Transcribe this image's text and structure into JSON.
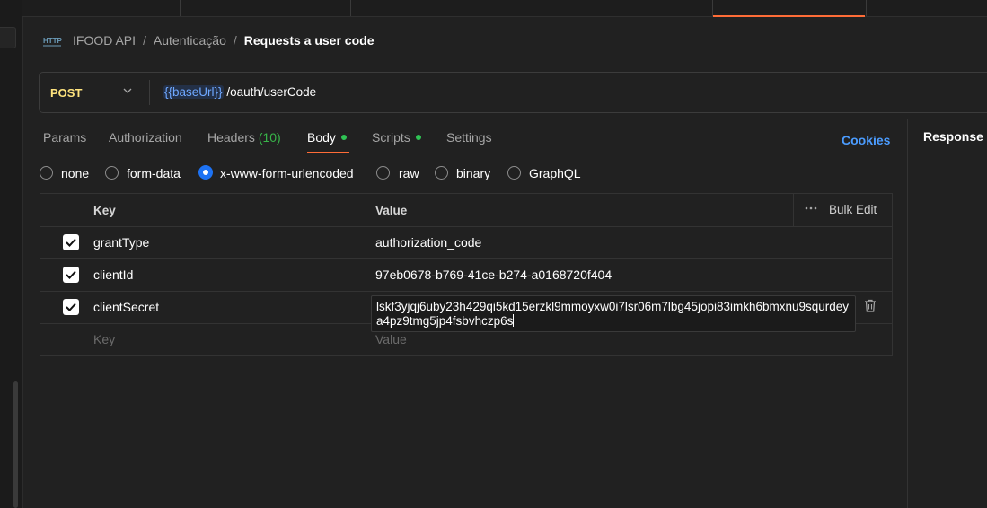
{
  "breadcrumb": {
    "collection": "IFOOD API",
    "folder": "Autenticação",
    "request": "Requests a user code",
    "icon": "http-icon"
  },
  "request": {
    "method": "POST",
    "url_variable": "{{baseUrl}}",
    "url_path": "/oauth/userCode"
  },
  "tabs": {
    "params": "Params",
    "authorization": "Authorization",
    "headers": "Headers",
    "headers_count": "(10)",
    "body": "Body",
    "scripts": "Scripts",
    "settings": "Settings",
    "active": "Body"
  },
  "cookies_label": "Cookies",
  "response_title": "Response",
  "body_types": {
    "options": [
      "none",
      "form-data",
      "x-www-form-urlencoded",
      "raw",
      "binary",
      "GraphQL"
    ],
    "selected": "x-www-form-urlencoded"
  },
  "table": {
    "key_header": "Key",
    "value_header": "Value",
    "bulk_edit": "Bulk Edit",
    "rows": [
      {
        "checked": true,
        "key": "grantType",
        "value": "authorization_code"
      },
      {
        "checked": true,
        "key": "clientId",
        "value": "97eb0678-b769-41ce-b274-a0168720f404"
      },
      {
        "checked": true,
        "key": "clientSecret",
        "value": "lskf3yjqj6uby23h429qi5kd15erzkl9mmoyxw0i7lsr06m7lbg45jopi83imkh6bmxnu9squrdeya4pz9tmg5jp4fsbvhczp6s"
      }
    ],
    "placeholder_key": "Key",
    "placeholder_value": "Value"
  },
  "colors": {
    "accent": "#ff6c37",
    "method": "#ffe47e",
    "link": "#4b9cff",
    "status_dot": "#2fc354",
    "radio_selected": "#1d72f3"
  }
}
